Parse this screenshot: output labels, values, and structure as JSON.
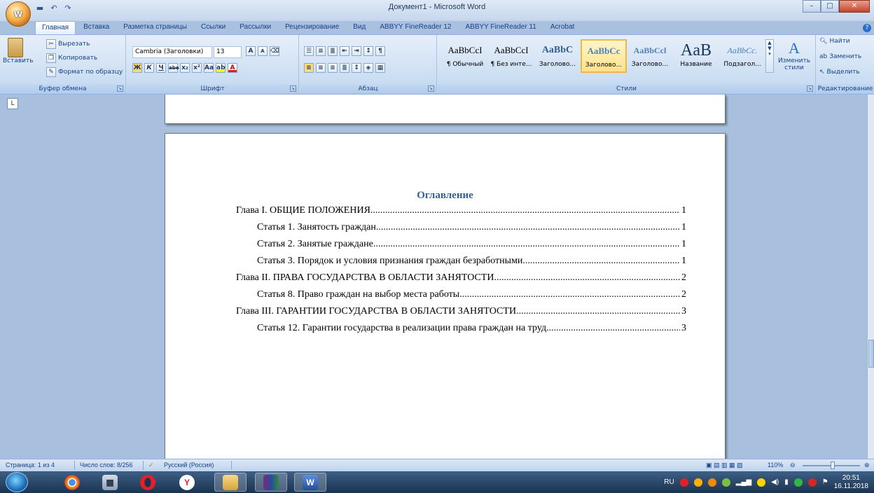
{
  "window": {
    "title": "Документ1 - Microsoft Word",
    "office_button_glyph": "W"
  },
  "quick_access": [
    "save-icon",
    "undo-icon",
    "redo-icon"
  ],
  "tabs": [
    {
      "label": "Главная",
      "active": true
    },
    {
      "label": "Вставка"
    },
    {
      "label": "Разметка страницы"
    },
    {
      "label": "Ссылки"
    },
    {
      "label": "Рассылки"
    },
    {
      "label": "Рецензирование"
    },
    {
      "label": "Вид"
    },
    {
      "label": "ABBYY FineReader 12"
    },
    {
      "label": "ABBYY FineReader 11"
    },
    {
      "label": "Acrobat"
    }
  ],
  "clipboard": {
    "paste": "Вставить",
    "cut": "Вырезать",
    "copy": "Копировать",
    "format_painter": "Формат по образцу",
    "group": "Буфер обмена"
  },
  "font": {
    "name": "Cambria (Заголовки)",
    "size": "13",
    "group": "Шрифт",
    "bold": "Ж",
    "italic": "К",
    "underline": "Ч",
    "strike": "abe",
    "subscript": "x₂",
    "superscript": "x²",
    "case": "Aa",
    "grow": "A",
    "shrink": "A"
  },
  "paragraph": {
    "group": "Абзац",
    "pilcrow": "¶"
  },
  "styles": {
    "group": "Стили",
    "items": [
      {
        "sample": "AaBbCcI",
        "name": "¶ Обычный"
      },
      {
        "sample": "AaBbCcI",
        "name": "¶ Без инте..."
      },
      {
        "sample": "AaBbC",
        "name": "Заголово..."
      },
      {
        "sample": "AaBbCc",
        "name": "Заголово...",
        "selected": true
      },
      {
        "sample": "AaBbCcl",
        "name": "Заголово..."
      },
      {
        "sample": "AaB",
        "name": "Название"
      },
      {
        "sample": "AaBbCc.",
        "name": "Подзагол..."
      }
    ],
    "change": "Изменить стили"
  },
  "editing": {
    "group": "Редактирование",
    "find": "Найти",
    "replace": "Заменить",
    "select": "Выделить"
  },
  "ruler_glyph": "L",
  "document": {
    "toc_title": "Оглавление",
    "entries": [
      {
        "text": "Глава I. ОБЩИЕ ПОЛОЖЕНИЯ",
        "page": "1",
        "level": 1
      },
      {
        "text": "Статья 1. Занятость граждан",
        "page": "1",
        "level": 2
      },
      {
        "text": "Статья 2. Занятые граждане",
        "page": "1",
        "level": 2
      },
      {
        "text": "Статья 3. Порядок и условия признания граждан безработными",
        "page": "1",
        "level": 2
      },
      {
        "text": "Глава II. ПРАВА ГОСУДАРСТВА В ОБЛАСТИ ЗАНЯТОСТИ",
        "page": "2",
        "level": 1
      },
      {
        "text": "Статья 8. Право граждан на выбор места работы",
        "page": "2",
        "level": 2
      },
      {
        "text": "Глава III. ГАРАНТИИ ГОСУДАРСТВА В ОБЛАСТИ ЗАНЯТОСТИ",
        "page": "3",
        "level": 1
      },
      {
        "text": "Статья 12. Гарантии государства в реализации права граждан на труд",
        "page": "3",
        "level": 2
      }
    ]
  },
  "status": {
    "page": "Страница: 1 из 4",
    "words": "Число слов: 8/256",
    "language": "Русский (Россия)",
    "zoom": "110%"
  },
  "taskbar": {
    "apps": [
      "chrome-icon",
      "calculator-icon",
      "opera-icon",
      "yandex-browser-icon",
      "explorer-icon",
      "winrar-icon",
      "word-icon"
    ],
    "lang": "RU",
    "time": "20:51",
    "date": "16.11.2018"
  }
}
